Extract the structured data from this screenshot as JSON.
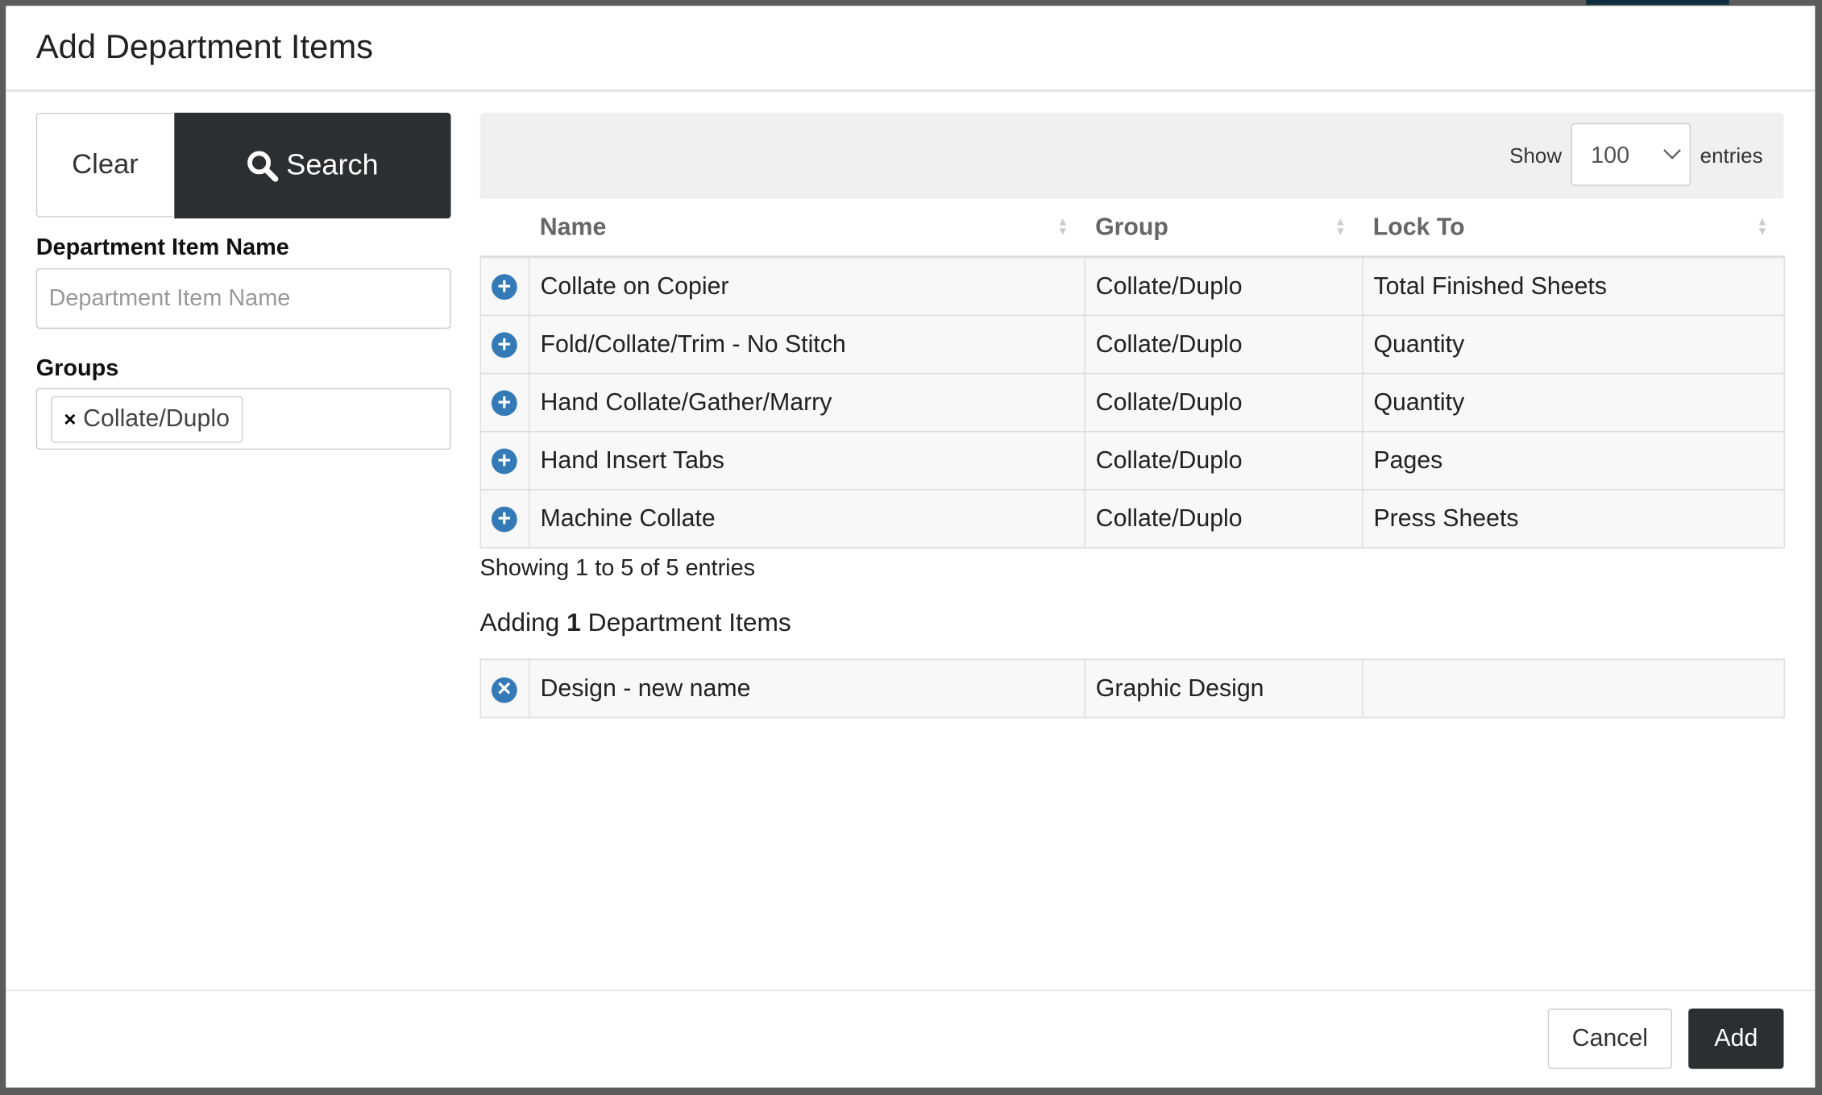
{
  "modal": {
    "title": "Add Department Items"
  },
  "filters": {
    "clear_label": "Clear",
    "search_label": "Search",
    "name_label": "Department Item Name",
    "name_placeholder": "Department Item Name",
    "name_value": "",
    "groups_label": "Groups",
    "groups_selected": [
      "Collate/Duplo"
    ]
  },
  "table": {
    "show_label": "Show",
    "entries_label": "entries",
    "page_size": "100",
    "columns": [
      "Name",
      "Group",
      "Lock To"
    ],
    "rows": [
      {
        "name": "Collate on Copier",
        "group": "Collate/Duplo",
        "lock_to": "Total Finished Sheets"
      },
      {
        "name": "Fold/Collate/Trim - No Stitch",
        "group": "Collate/Duplo",
        "lock_to": "Quantity"
      },
      {
        "name": "Hand Collate/Gather/Marry",
        "group": "Collate/Duplo",
        "lock_to": "Quantity"
      },
      {
        "name": "Hand Insert Tabs",
        "group": "Collate/Duplo",
        "lock_to": "Pages"
      },
      {
        "name": "Machine Collate",
        "group": "Collate/Duplo",
        "lock_to": "Press Sheets"
      }
    ],
    "info": "Showing 1 to 5 of 5 entries"
  },
  "adding": {
    "prefix": "Adding",
    "count": "1",
    "suffix": "Department Items",
    "rows": [
      {
        "name": "Design - new name",
        "group": "Graphic Design",
        "lock_to": ""
      }
    ]
  },
  "footer": {
    "cancel_label": "Cancel",
    "add_label": "Add"
  },
  "colors": {
    "accent_icon": "#337ab7",
    "dark_button": "#2b2f32"
  }
}
